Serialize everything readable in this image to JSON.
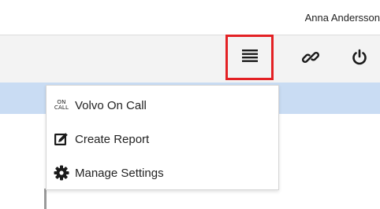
{
  "header": {
    "user_name": "Anna Andersson"
  },
  "toolbar": {
    "buttons": [
      {
        "icon": "hamburger-menu-icon",
        "highlighted": true,
        "highlight_color": "#e32124"
      },
      {
        "icon": "link-icon"
      },
      {
        "icon": "power-icon"
      }
    ]
  },
  "menu": {
    "items": [
      {
        "icon": "on-call-icon",
        "icon_text_top": "ON",
        "icon_text_bottom": "CALL",
        "label": "Volvo On Call"
      },
      {
        "icon": "edit-icon",
        "label": "Create Report"
      },
      {
        "icon": "gear-icon",
        "label": "Manage Settings"
      }
    ]
  },
  "colors": {
    "toolbar_bg": "#f3f3f3",
    "band_bg": "#c9dcf3",
    "icon_color": "#1a1a1a"
  }
}
